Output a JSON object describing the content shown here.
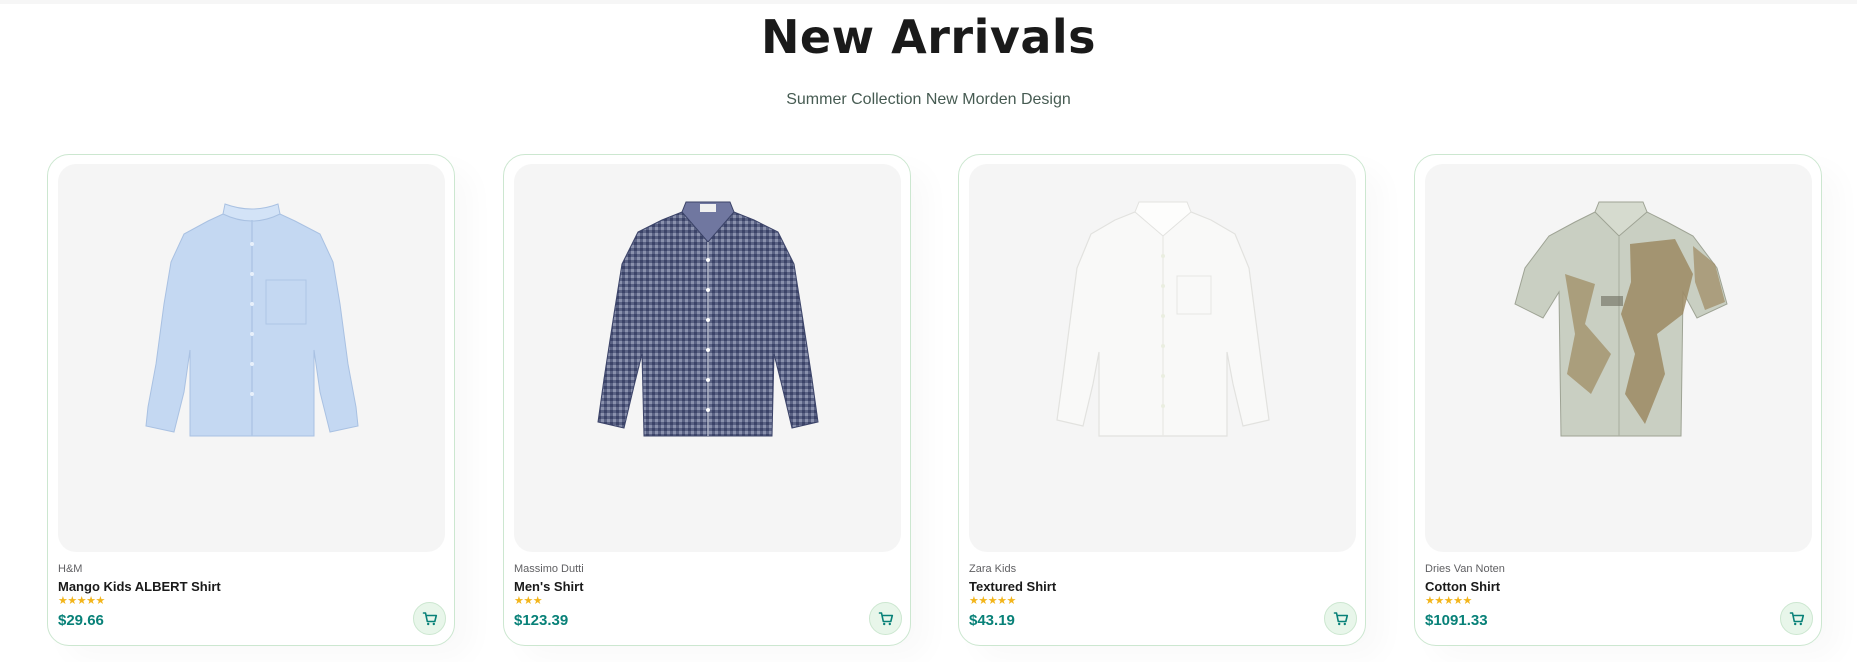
{
  "section": {
    "title": "New Arrivals",
    "subtitle": "Summer Collection New Morden Design"
  },
  "products": [
    {
      "brand": "H&M",
      "name": "Mango Kids ALBERT Shirt",
      "rating": 5,
      "stars": "★★★★★",
      "price": "$29.66",
      "image": "light-blue-shirt",
      "cart_icon": "cart-icon"
    },
    {
      "brand": "Massimo Dutti",
      "name": "Men's Shirt",
      "rating": 3,
      "stars": "★★★",
      "price": "$123.39",
      "image": "navy-gingham-shirt",
      "cart_icon": "cart-icon"
    },
    {
      "brand": "Zara Kids",
      "name": "Textured Shirt",
      "rating": 5,
      "stars": "★★★★★",
      "price": "$43.19",
      "image": "white-shirt",
      "cart_icon": "cart-icon"
    },
    {
      "brand": "Dries Van Noten",
      "name": "Cotton Shirt",
      "rating": 5,
      "stars": "★★★★★",
      "price": "$1091.33",
      "image": "printed-short-sleeve-shirt",
      "cart_icon": "cart-icon"
    }
  ],
  "colors": {
    "accent": "#088178",
    "border": "#cce7d0",
    "star": "#f3b51b",
    "card_image_bg": "#f5f5f5"
  }
}
